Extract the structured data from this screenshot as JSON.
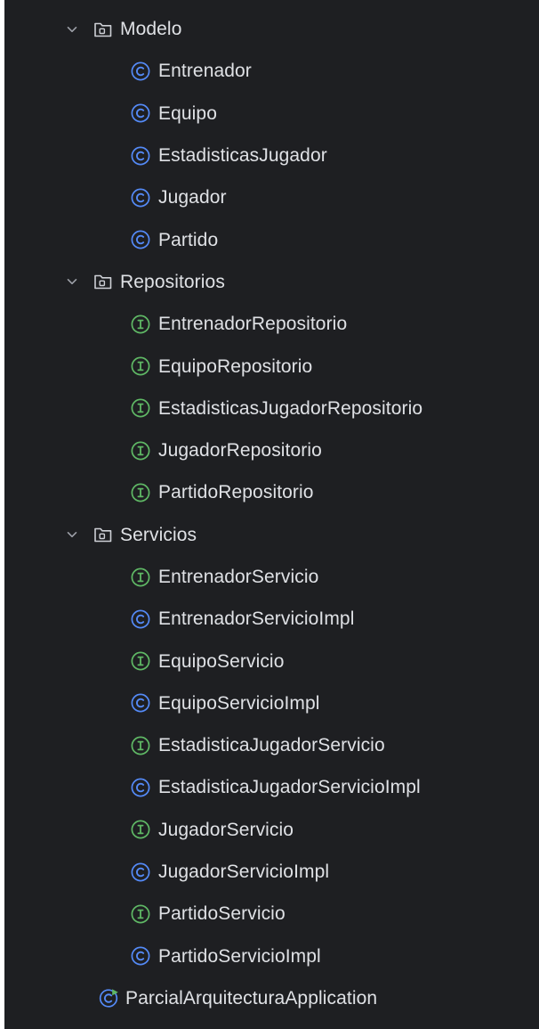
{
  "colors": {
    "background": "#1e1f22",
    "text": "#dfe1e5",
    "class_icon": "#548af7",
    "interface_icon": "#5fb865",
    "chevron": "#9da0a8",
    "folder_icon": "#ced0d6"
  },
  "tree": {
    "packages": [
      {
        "name": "Modelo",
        "expanded": true,
        "icon": "folder-package-icon",
        "items": [
          {
            "name": "Entrenador",
            "kind": "class"
          },
          {
            "name": "Equipo",
            "kind": "class"
          },
          {
            "name": "EstadisticasJugador",
            "kind": "class"
          },
          {
            "name": "Jugador",
            "kind": "class"
          },
          {
            "name": "Partido",
            "kind": "class"
          }
        ]
      },
      {
        "name": "Repositorios",
        "expanded": true,
        "icon": "folder-package-icon",
        "items": [
          {
            "name": "EntrenadorRepositorio",
            "kind": "interface"
          },
          {
            "name": "EquipoRepositorio",
            "kind": "interface"
          },
          {
            "name": "EstadisticasJugadorRepositorio",
            "kind": "interface"
          },
          {
            "name": "JugadorRepositorio",
            "kind": "interface"
          },
          {
            "name": "PartidoRepositorio",
            "kind": "interface"
          }
        ]
      },
      {
        "name": "Servicios",
        "expanded": true,
        "icon": "folder-package-icon",
        "items": [
          {
            "name": "EntrenadorServicio",
            "kind": "interface"
          },
          {
            "name": "EntrenadorServicioImpl",
            "kind": "class"
          },
          {
            "name": "EquipoServicio",
            "kind": "interface"
          },
          {
            "name": "EquipoServicioImpl",
            "kind": "class"
          },
          {
            "name": "EstadisticaJugadorServicio",
            "kind": "interface"
          },
          {
            "name": "EstadisticaJugadorServicioImpl",
            "kind": "class"
          },
          {
            "name": "JugadorServicio",
            "kind": "interface"
          },
          {
            "name": "JugadorServicioImpl",
            "kind": "class"
          },
          {
            "name": "PartidoServicio",
            "kind": "interface"
          },
          {
            "name": "PartidoServicioImpl",
            "kind": "class"
          }
        ]
      }
    ],
    "application": {
      "name": "ParcialArquitecturaApplication",
      "kind": "spring-boot-application",
      "icon": "spring-boot-class-icon"
    }
  }
}
